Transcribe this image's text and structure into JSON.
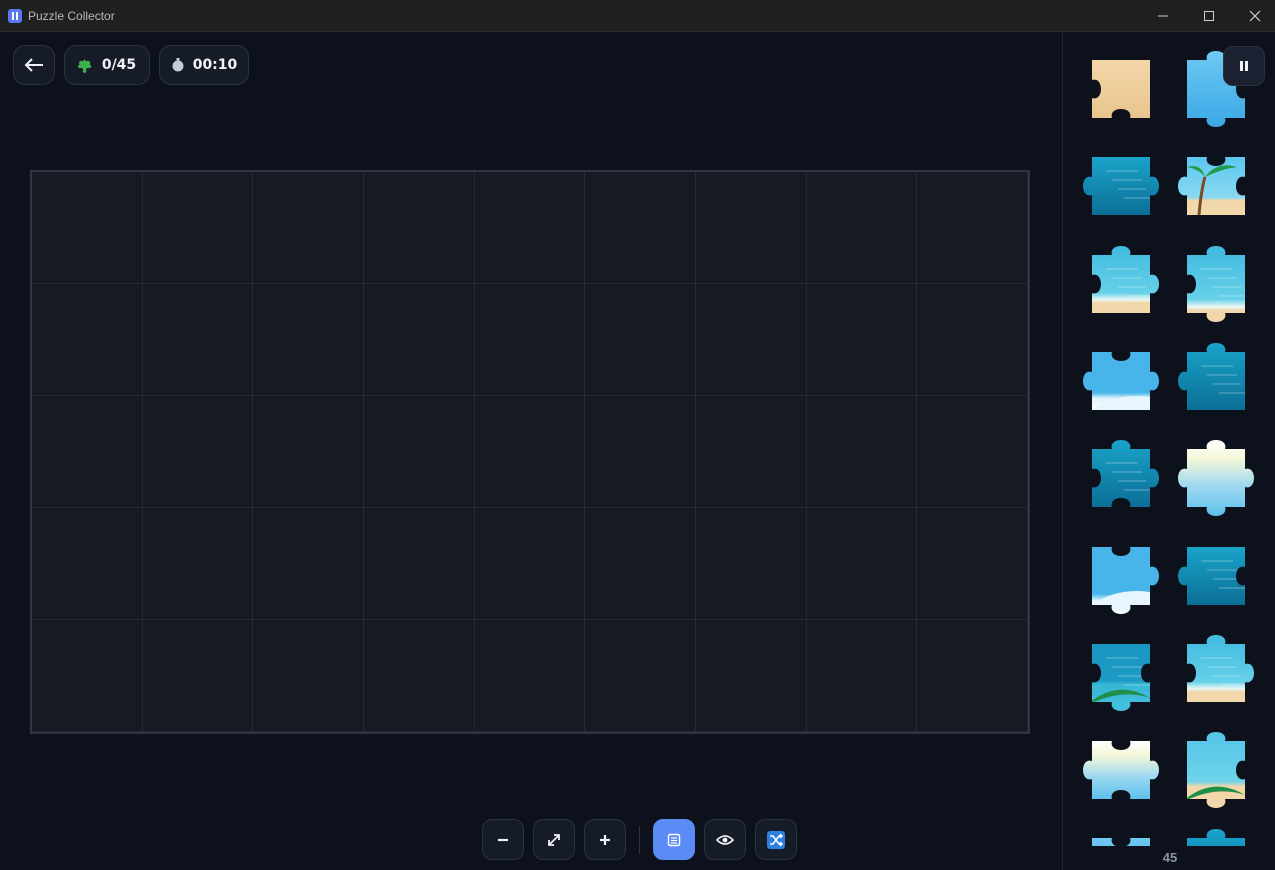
{
  "window": {
    "title": "Puzzle Collector"
  },
  "hud": {
    "placed": "0/45",
    "timer": "00:10"
  },
  "board": {
    "rows": 5,
    "cols": 9
  },
  "tray": {
    "count": "45",
    "pieces": [
      {
        "kind": "sand",
        "tabs": "TnRnBsLs"
      },
      {
        "kind": "sky",
        "tabs": "TtRsBtLn"
      },
      {
        "kind": "sea",
        "tabs": "TnRtBnLt"
      },
      {
        "kind": "palm",
        "tabs": "TsRsBnLt"
      },
      {
        "kind": "shore",
        "tabs": "TtRtBnLs"
      },
      {
        "kind": "shore",
        "tabs": "TtRnBtLs"
      },
      {
        "kind": "wave",
        "tabs": "TsRtBnLt"
      },
      {
        "kind": "sea",
        "tabs": "TtRnBnLt"
      },
      {
        "kind": "sea",
        "tabs": "TtRtBsLs"
      },
      {
        "kind": "sun",
        "tabs": "TtRtBtLt"
      },
      {
        "kind": "wave",
        "tabs": "TsRtBtLn"
      },
      {
        "kind": "sea",
        "tabs": "TnRsBnLt"
      },
      {
        "kind": "leaf",
        "tabs": "TnRsBtLs"
      },
      {
        "kind": "shore",
        "tabs": "TtRtBnLs"
      },
      {
        "kind": "sun",
        "tabs": "TsRtBsLt"
      },
      {
        "kind": "leafshore",
        "tabs": "TtRsBtLn"
      },
      {
        "kind": "sky",
        "tabs": "TsRsBsLs"
      },
      {
        "kind": "sea",
        "tabs": "TtRsBsLs"
      }
    ]
  },
  "colors": {
    "accent": "#5b8cf5",
    "background": "#0c111c",
    "board": "#161a23",
    "sea": "#1596c0",
    "sky": "#5bc3ef",
    "sand": "#f1d3a5"
  }
}
